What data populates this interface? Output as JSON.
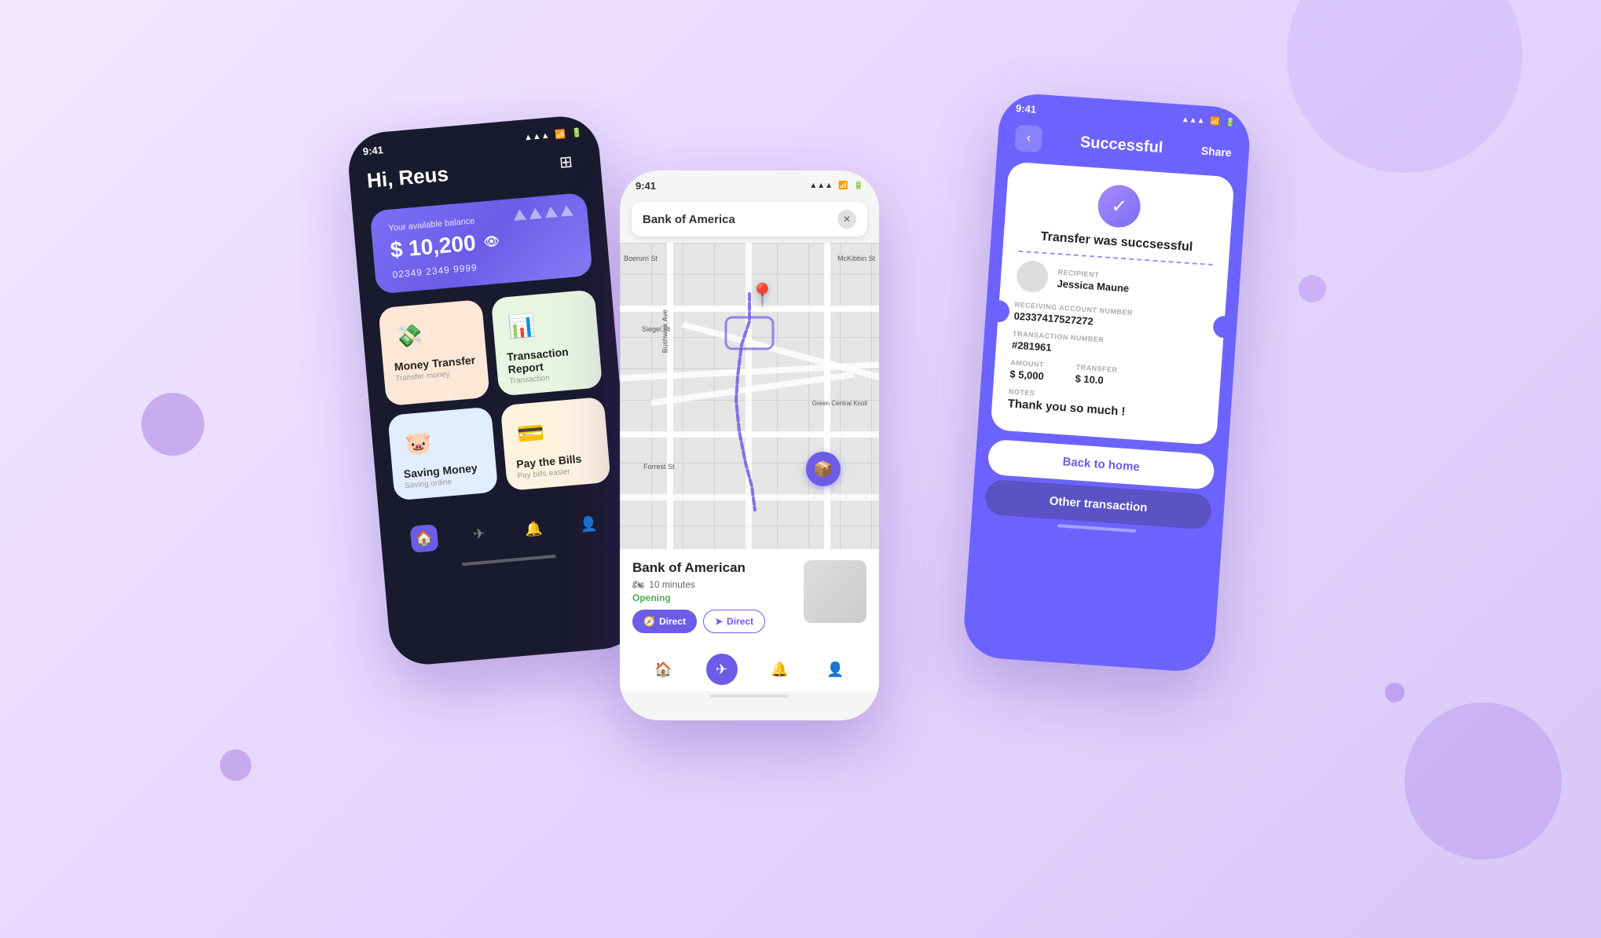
{
  "background": {
    "gradient_start": "#f0e8ff",
    "gradient_end": "#d8c8f8"
  },
  "phone_left": {
    "status_time": "9:41",
    "greeting": "Hi, Reus",
    "balance_label": "Your available balance",
    "balance_amount": "$ 10,200",
    "card_number": "02349 2349 9999",
    "menu_items": [
      {
        "title": "Money Transfer",
        "subtitle": "Transfer money",
        "color": "peach",
        "icon": "💸"
      },
      {
        "title": "Transaction Report",
        "subtitle": "Transaction",
        "color": "green",
        "icon": "📊"
      },
      {
        "title": "Saving Money",
        "subtitle": "Saving online",
        "color": "blue",
        "icon": "🐷"
      },
      {
        "title": "Pay the Bills",
        "subtitle": "Pay bills easier",
        "color": "orange",
        "icon": "💳"
      }
    ]
  },
  "phone_middle": {
    "status_time": "9:41",
    "search_placeholder": "Bank of America",
    "place_name": "Bank of American",
    "place_time": "10 minutes",
    "place_status": "Opening",
    "direct_btn1": "Direct",
    "direct_btn2": "Direct",
    "map_labels": [
      "Boerurn St",
      "McKibbin St",
      "Bushwick Ave",
      "Siegel St",
      "Forrest St",
      "Green Central Knoll"
    ]
  },
  "phone_right": {
    "status_time": "9:41",
    "page_title": "Successful",
    "share_label": "Share",
    "success_message": "Transfer was succsessful",
    "recipient_label": "RECIPIENT",
    "recipient_name": "Jessica Maune",
    "account_label": "RECEIVING ACCOUNT NUMBER",
    "account_number": "02337417527272",
    "transaction_label": "TRANSACTION NUMBER",
    "transaction_number": "#281961",
    "amount_label": "AMOUNT",
    "amount_value": "$ 5,000",
    "transfer_label": "TRANSFER",
    "transfer_value": "$ 10.0",
    "notes_label": "NOTES",
    "notes_value": "Thank you so much !",
    "back_home_label": "Back to home",
    "other_transaction_label": "Other transaction"
  }
}
